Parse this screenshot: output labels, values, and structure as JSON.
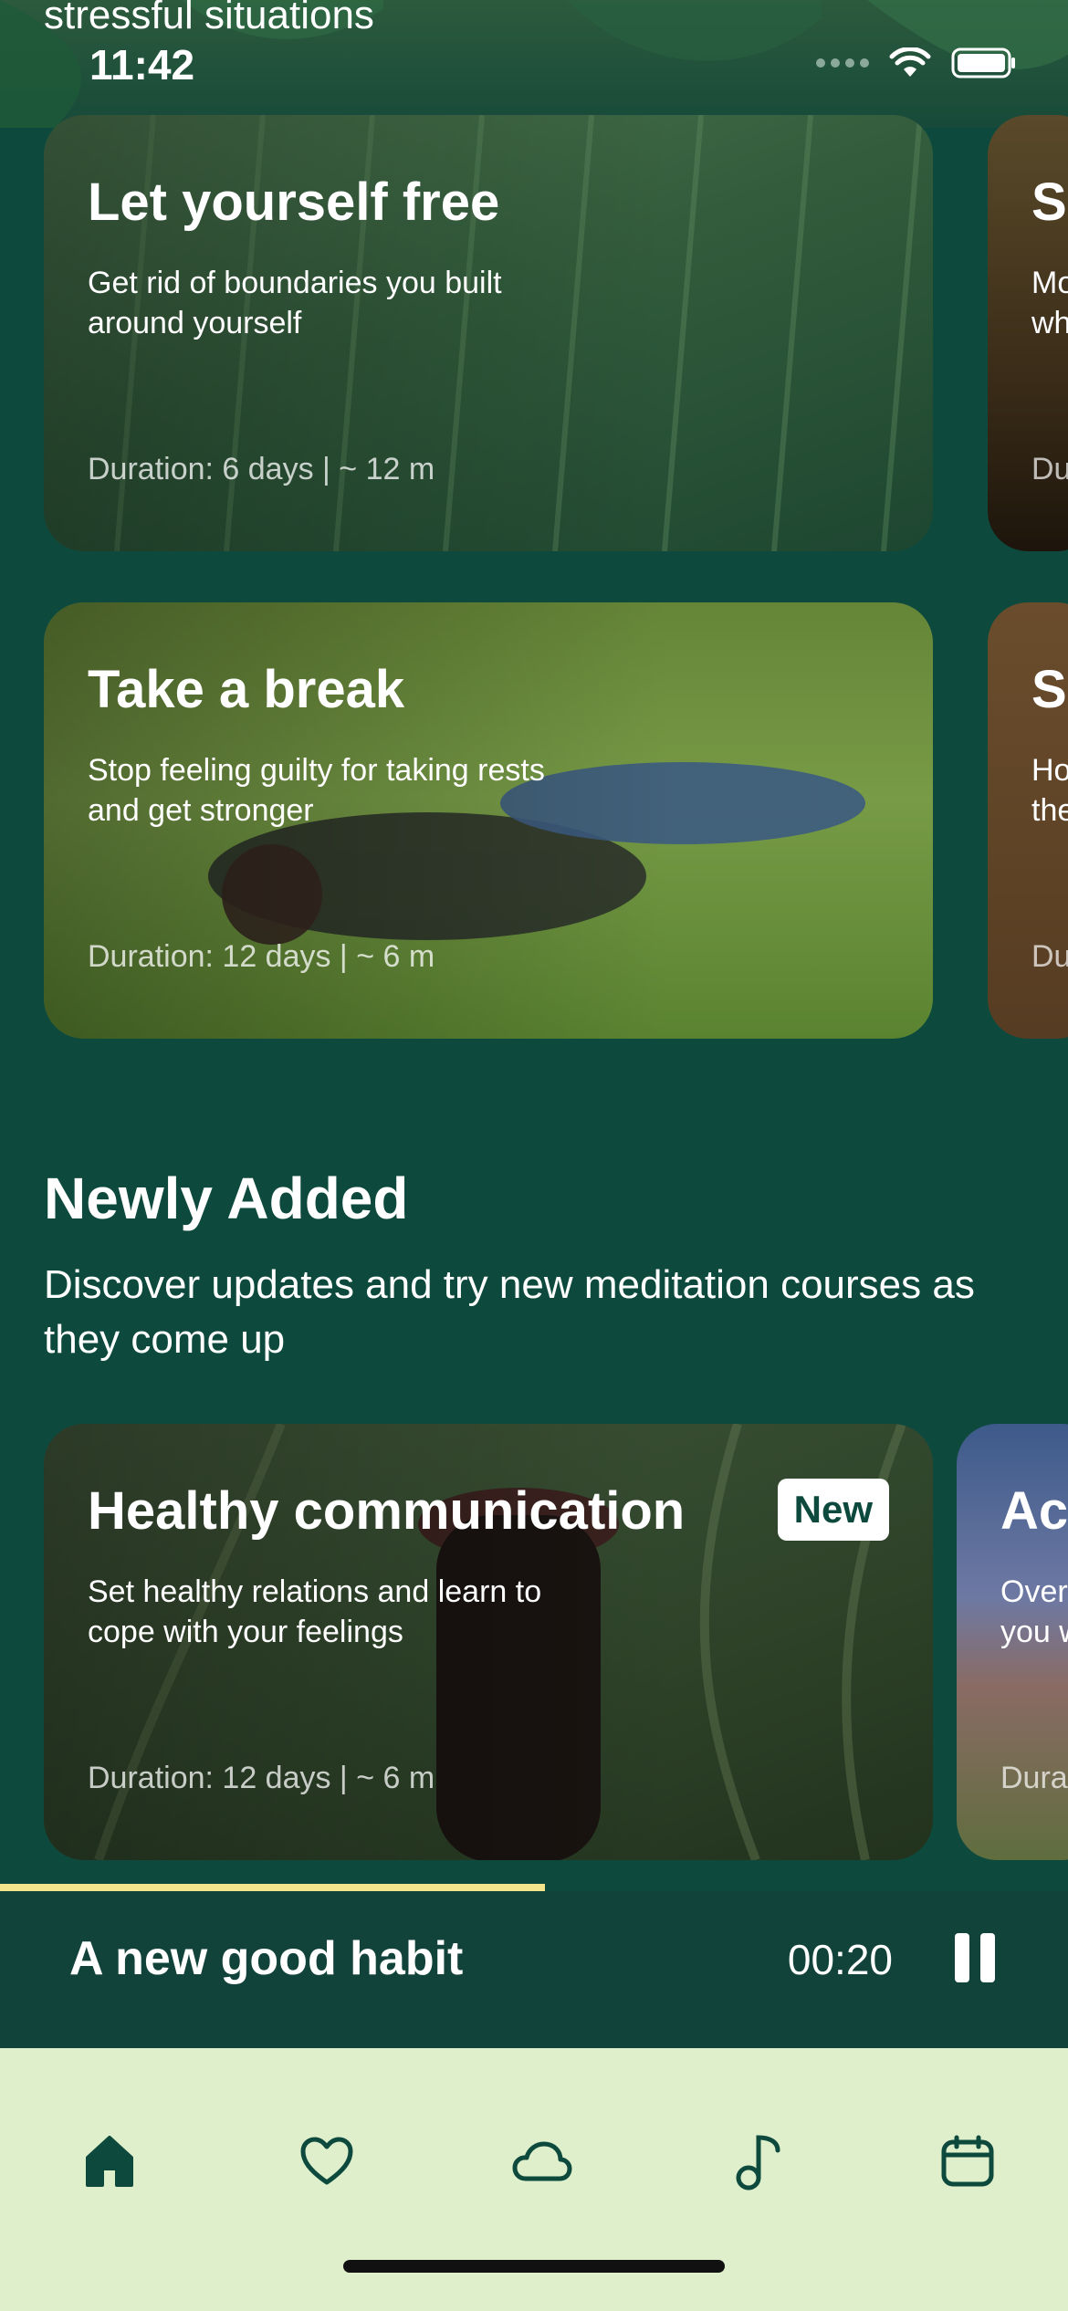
{
  "status_bar": {
    "cut_off_text": "stressful situations",
    "time": "11:42"
  },
  "cards_row1": {
    "main": {
      "title": "Let yourself free",
      "description": "Get rid of boundaries you built around yourself",
      "duration": "Duration: 6 days | ~ 12 m"
    },
    "peek": {
      "title": "S",
      "desc_line1": "Mo",
      "desc_line2": "wh",
      "duration": "Du"
    }
  },
  "cards_row2": {
    "main": {
      "title": "Take a break",
      "description": "Stop feeling guilty for taking rests and get stronger",
      "duration": "Duration: 12 days | ~ 6 m"
    },
    "peek": {
      "title": "S",
      "desc_line1": "Ho",
      "desc_line2": "the",
      "duration": "Du"
    }
  },
  "newly_added": {
    "title": "Newly Added",
    "subtitle": "Discover updates and try new meditation courses as they come up",
    "main": {
      "title": "Healthy communication",
      "badge": "New",
      "description": "Set healthy relations and learn to cope with your feelings",
      "duration": "Duration: 12 days | ~ 6 m"
    },
    "peek": {
      "title": "Ac",
      "desc_line1": "Over",
      "desc_line2": "you w",
      "duration": "Dura"
    }
  },
  "player": {
    "title": "A new good habit",
    "time": "00:20",
    "progress": 0.51
  },
  "tabbar": {
    "items": [
      "home-icon",
      "heart-icon",
      "cloud-icon",
      "music-note-icon",
      "calendar-icon"
    ],
    "active": "home-icon"
  },
  "colors": {
    "background": "#0d4a3d",
    "player_bg": "#12433a",
    "tabbar_bg": "#dfeecb",
    "progress": "#f3e58c",
    "tab_icon": "#0d4a3d"
  }
}
